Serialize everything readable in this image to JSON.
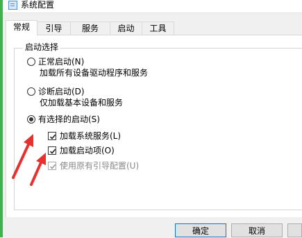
{
  "window": {
    "title": "系统配置"
  },
  "tabs": [
    {
      "label": "常规"
    },
    {
      "label": "引导"
    },
    {
      "label": "服务"
    },
    {
      "label": "启动"
    },
    {
      "label": "工具"
    }
  ],
  "startup_group": {
    "legend": "启动选择",
    "options": [
      {
        "label": "正常启动(N)",
        "description": "加载所有设备驱动程序和服务",
        "selected": false
      },
      {
        "label": "诊断启动(D)",
        "description": "仅加载基本设备和服务",
        "selected": false
      },
      {
        "label": "有选择的启动(S)",
        "selected": true
      }
    ],
    "selective_items": [
      {
        "label": "加载系统服务(L)",
        "checked": true,
        "enabled": true
      },
      {
        "label": "加载启动项(O)",
        "checked": true,
        "enabled": true
      },
      {
        "label": "使用原有引导配置(U)",
        "checked": true,
        "enabled": false
      }
    ]
  },
  "buttons": {
    "ok": "确定",
    "cancel": "取消"
  },
  "colors": {
    "annotation_arrow": "#e8312f",
    "accent": "#0078d7",
    "left_strip": "#3cb44b"
  },
  "icons": {
    "title": "system-config-icon"
  }
}
